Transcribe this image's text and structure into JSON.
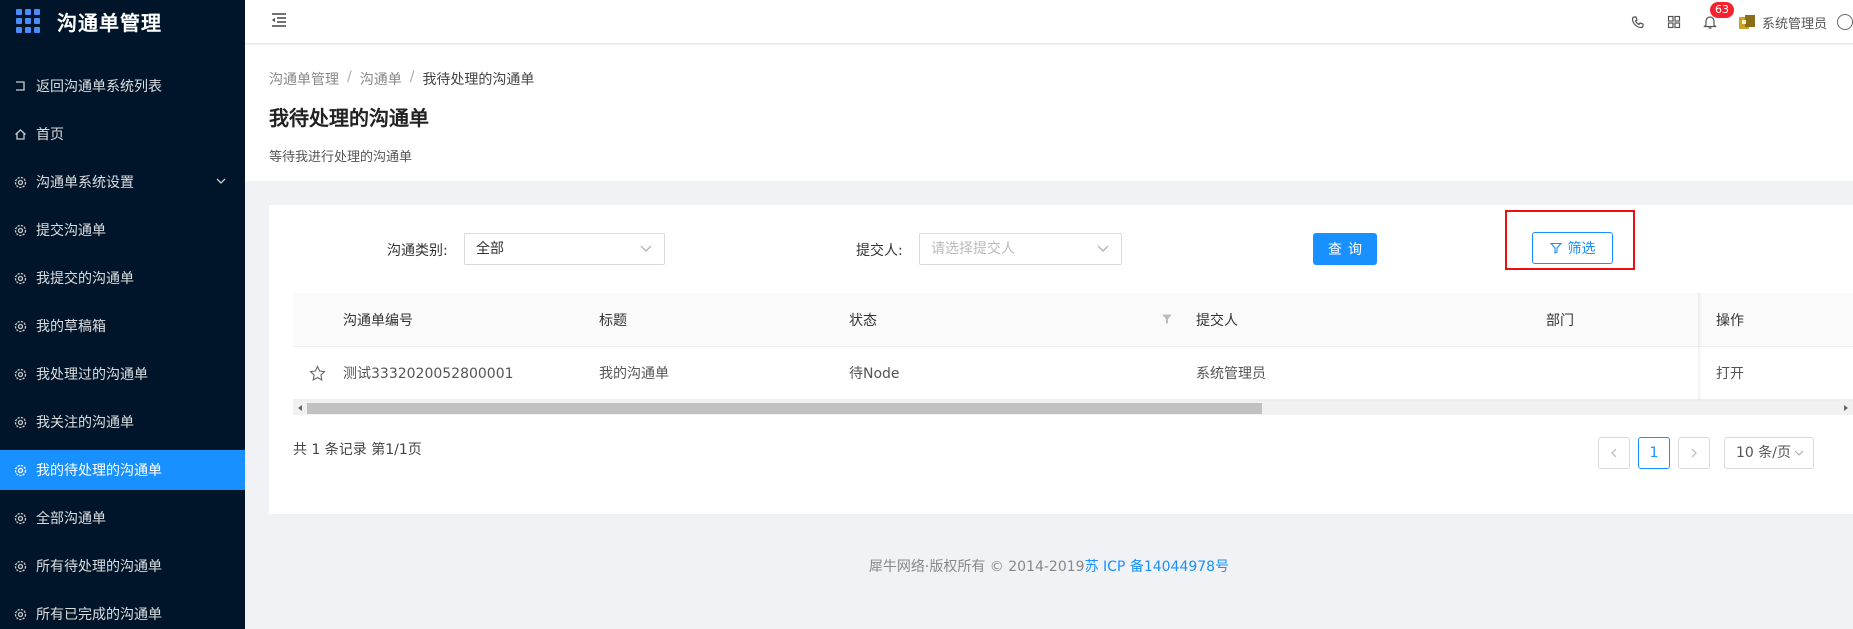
{
  "app": {
    "title": "沟通单管理"
  },
  "sidebar": {
    "items": [
      {
        "label": "返回沟通单系统列表",
        "icon": "return-icon"
      },
      {
        "label": "首页",
        "icon": "home-icon"
      },
      {
        "label": "沟通单系统设置",
        "icon": "gear-icon",
        "expandable": true
      },
      {
        "label": "提交沟通单",
        "icon": "gear-icon"
      },
      {
        "label": "我提交的沟通单",
        "icon": "gear-icon"
      },
      {
        "label": "我的草稿箱",
        "icon": "gear-icon"
      },
      {
        "label": "我处理过的沟通单",
        "icon": "gear-icon"
      },
      {
        "label": "我关注的沟通单",
        "icon": "gear-icon"
      },
      {
        "label": "我的待处理的沟通单",
        "icon": "gear-icon",
        "active": true
      },
      {
        "label": "全部沟通单",
        "icon": "gear-icon"
      },
      {
        "label": "所有待处理的沟通单",
        "icon": "gear-icon"
      },
      {
        "label": "所有已完成的沟通单",
        "icon": "gear-icon"
      }
    ]
  },
  "header": {
    "notification_count": "63",
    "user_name": "系统管理员"
  },
  "breadcrumb": {
    "items": [
      "沟通单管理",
      "沟通单",
      "我待处理的沟通单"
    ],
    "separator": "/"
  },
  "page": {
    "title": "我待处理的沟通单",
    "description": "等待我进行处理的沟通单"
  },
  "filters": {
    "category_label": "沟通类别:",
    "category_value": "全部",
    "submitter_label": "提交人:",
    "submitter_placeholder": "请选择提交人",
    "query_button": "查询",
    "filter_button": "筛选"
  },
  "table": {
    "columns": [
      "沟通单编号",
      "标题",
      "状态",
      "提交人",
      "部门",
      "操作"
    ],
    "rows": [
      {
        "id": "测试3332020052800001",
        "title": "我的沟通单",
        "status": "待Node",
        "submitter": "系统管理员",
        "department": "",
        "action": "打开"
      }
    ]
  },
  "pagination": {
    "summary": "共 1 条记录 第1/1页",
    "current_page": "1",
    "page_size": "10 条/页",
    "prev": "<",
    "next": ">"
  },
  "footer": {
    "copyright": "犀牛网络·版权所有 © 2014-2019",
    "icp": "苏 ICP 备14044978号"
  },
  "colors": {
    "sidebar_bg": "#001529",
    "primary": "#1890ff",
    "highlight_box": "#e81010",
    "badge": "#f5222d"
  }
}
